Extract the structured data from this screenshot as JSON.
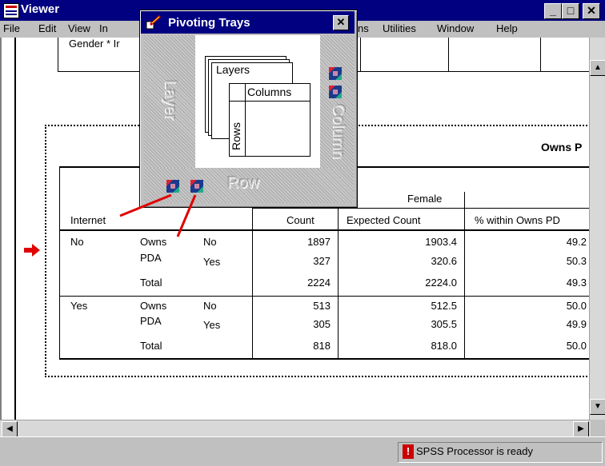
{
  "window": {
    "title": "Viewer"
  },
  "menu": [
    "File",
    "Edit",
    "View",
    "In",
    "ns",
    "Utilities",
    "Window",
    "Help"
  ],
  "fragment": {
    "text": "Gender * Ir"
  },
  "pivot_tray": {
    "title": "Pivoting Trays",
    "tray_layer": "Layer",
    "tray_column": "Column",
    "tray_row": "Row",
    "diagram": {
      "layers": "Layers",
      "columns": "Columns",
      "rows": "Rows"
    }
  },
  "table": {
    "partial_title": "Owns P",
    "col_group": "Female",
    "row_header": "Internet",
    "col_headers": [
      "Count",
      "Expected Count",
      "% within Owns PD"
    ],
    "rows": [
      {
        "g1": "No",
        "g2": "Owns",
        "g2b": "PDA",
        "g3": "No",
        "c1": "1897",
        "c2": "1903.4",
        "c3": "49.2"
      },
      {
        "g1": "",
        "g2": "",
        "g2b": "",
        "g3": "Yes",
        "c1": "327",
        "c2": "320.6",
        "c3": "50.3"
      },
      {
        "g1": "",
        "g2": "Total",
        "g2b": "",
        "g3": "",
        "c1": "2224",
        "c2": "2224.0",
        "c3": "49.3"
      },
      {
        "g1": "Yes",
        "g2": "Owns",
        "g2b": "PDA",
        "g3": "No",
        "c1": "513",
        "c2": "512.5",
        "c3": "50.0"
      },
      {
        "g1": "",
        "g2": "",
        "g2b": "",
        "g3": "Yes",
        "c1": "305",
        "c2": "305.5",
        "c3": "49.9"
      },
      {
        "g1": "",
        "g2": "Total",
        "g2b": "",
        "g3": "",
        "c1": "818",
        "c2": "818.0",
        "c3": "50.0"
      }
    ]
  },
  "status": {
    "text": "SPSS Processor  is ready"
  },
  "colors": {
    "titlebar": "#000080",
    "accent_red": "#e00000"
  }
}
